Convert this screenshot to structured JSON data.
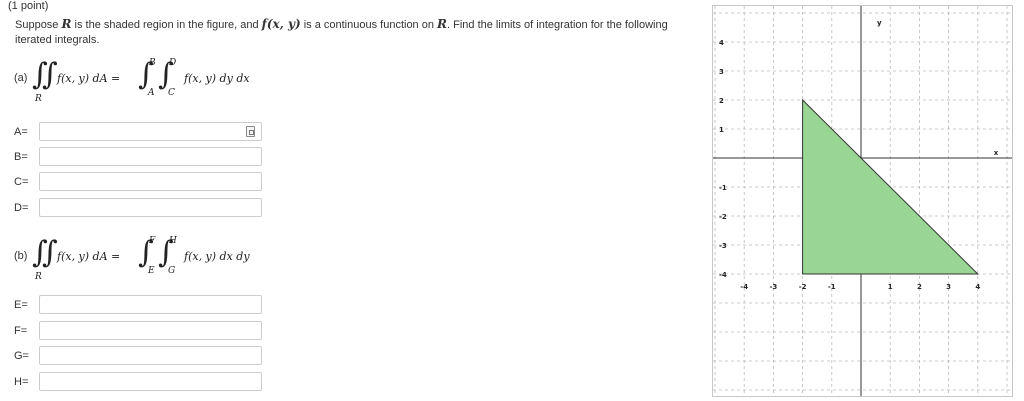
{
  "problem": {
    "points": "(1 point)",
    "statement": {
      "part1": "Suppose ",
      "R": "R",
      "part2": " is the shaded region in the figure, and ",
      "f": "f(x, y)",
      "part3": " is a continuous function on ",
      "R2": "R",
      "part4": ". Find the limits of integration for the following iterated integrals."
    }
  },
  "part_a": {
    "label": "(a)",
    "lhs": "f(x, y) dA =",
    "region": "R",
    "upper_outer": "B",
    "lower_outer": "A",
    "upper_inner": "D",
    "lower_inner": "C",
    "integrand": "f(x, y) dy dx",
    "fields": [
      {
        "label": "A=",
        "value": ""
      },
      {
        "label": "B=",
        "value": ""
      },
      {
        "label": "C=",
        "value": ""
      },
      {
        "label": "D=",
        "value": ""
      }
    ]
  },
  "part_b": {
    "label": "(b)",
    "lhs": "f(x, y) dA =",
    "region": "R",
    "upper_outer": "F",
    "lower_outer": "E",
    "upper_inner": "H",
    "lower_inner": "G",
    "integrand": "f(x, y) dx dy",
    "fields": [
      {
        "label": "E=",
        "value": ""
      },
      {
        "label": "F=",
        "value": ""
      },
      {
        "label": "G=",
        "value": ""
      },
      {
        "label": "H=",
        "value": ""
      }
    ]
  },
  "chart_data": {
    "type": "area",
    "xlabel": "x",
    "ylabel": "y",
    "xlim": [
      -4,
      4
    ],
    "ylim": [
      -4,
      4
    ],
    "grid": true,
    "x_ticks": [
      "-4",
      "-3",
      "-2",
      "-1",
      "1",
      "2",
      "3",
      "4"
    ],
    "y_ticks": [
      "4",
      "3",
      "2",
      "1",
      "-1",
      "-2",
      "-3",
      "-4"
    ],
    "x_tick_values": [
      -4,
      -3,
      -2,
      -1,
      1,
      2,
      3,
      4
    ],
    "y_tick_values": [
      4,
      3,
      2,
      1,
      -1,
      -2,
      -3,
      -4
    ],
    "region_vertices": [
      [
        -2,
        2
      ],
      [
        -2,
        -4
      ],
      [
        4,
        -4
      ]
    ],
    "fill_color": "#99d694",
    "stroke_color": "#333333"
  }
}
